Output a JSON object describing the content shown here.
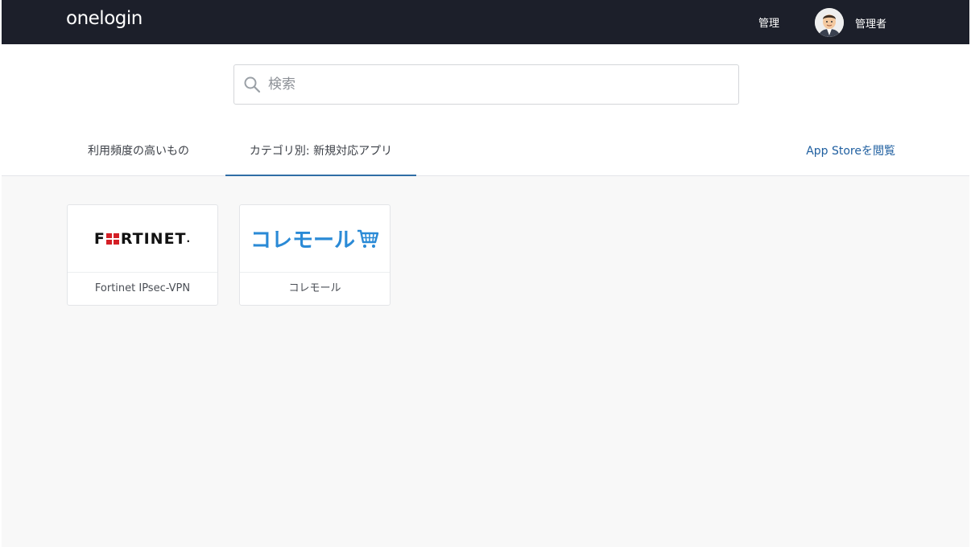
{
  "header": {
    "logo_text": "onelogin",
    "admin_label": "管理",
    "user_name": "管理者"
  },
  "search": {
    "placeholder": "検索",
    "value": ""
  },
  "tabs": [
    {
      "label": "利用頻度の高いもの",
      "active": false
    },
    {
      "label": "カテゴリ別: 新規対応アプリ",
      "active": true
    }
  ],
  "app_store_link": "App Storeを閲覧",
  "apps": [
    {
      "name": "Fortinet IPsec-VPN",
      "logo": {
        "text_before": "F",
        "text_after": "RTINET",
        "dot": "."
      }
    },
    {
      "name": "コレモール",
      "logo": {
        "text": "コレモール"
      }
    }
  ],
  "colors": {
    "header_bg": "#1c1f2a",
    "accent": "#2f6ea6",
    "link": "#1f5fa0",
    "fortinet_red": "#d41f26",
    "koremall_blue": "#2a8ad6"
  },
  "icons": {
    "search": "search-icon",
    "avatar": "user-avatar",
    "cart": "shopping-cart-icon"
  }
}
